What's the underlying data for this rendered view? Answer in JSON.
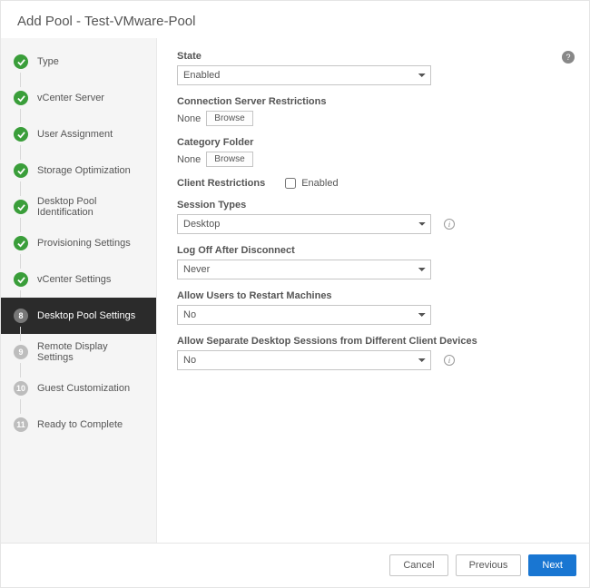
{
  "header": {
    "title": "Add Pool - Test-VMware-Pool"
  },
  "sidebar": {
    "steps": [
      {
        "num": "1",
        "label": "Type",
        "state": "done"
      },
      {
        "num": "2",
        "label": "vCenter Server",
        "state": "done"
      },
      {
        "num": "3",
        "label": "User Assignment",
        "state": "done"
      },
      {
        "num": "4",
        "label": "Storage Optimization",
        "state": "done"
      },
      {
        "num": "5",
        "label": "Desktop Pool Identification",
        "state": "done"
      },
      {
        "num": "6",
        "label": "Provisioning Settings",
        "state": "done"
      },
      {
        "num": "7",
        "label": "vCenter Settings",
        "state": "done"
      },
      {
        "num": "8",
        "label": "Desktop Pool Settings",
        "state": "current"
      },
      {
        "num": "9",
        "label": "Remote Display Settings",
        "state": "pending"
      },
      {
        "num": "10",
        "label": "Guest Customization",
        "state": "pending"
      },
      {
        "num": "11",
        "label": "Ready to Complete",
        "state": "pending"
      }
    ]
  },
  "form": {
    "state": {
      "label": "State",
      "value": "Enabled"
    },
    "connRestrictions": {
      "label": "Connection Server Restrictions",
      "value": "None",
      "browse": "Browse"
    },
    "categoryFolder": {
      "label": "Category Folder",
      "value": "None",
      "browse": "Browse"
    },
    "clientRestrictions": {
      "label": "Client Restrictions",
      "checkbox": "Enabled"
    },
    "sessionTypes": {
      "label": "Session Types",
      "value": "Desktop"
    },
    "logoff": {
      "label": "Log Off After Disconnect",
      "value": "Never"
    },
    "allowRestart": {
      "label": "Allow Users to Restart Machines",
      "value": "No"
    },
    "separateSessions": {
      "label": "Allow Separate Desktop Sessions from Different Client Devices",
      "value": "No"
    }
  },
  "footer": {
    "cancel": "Cancel",
    "previous": "Previous",
    "next": "Next"
  }
}
